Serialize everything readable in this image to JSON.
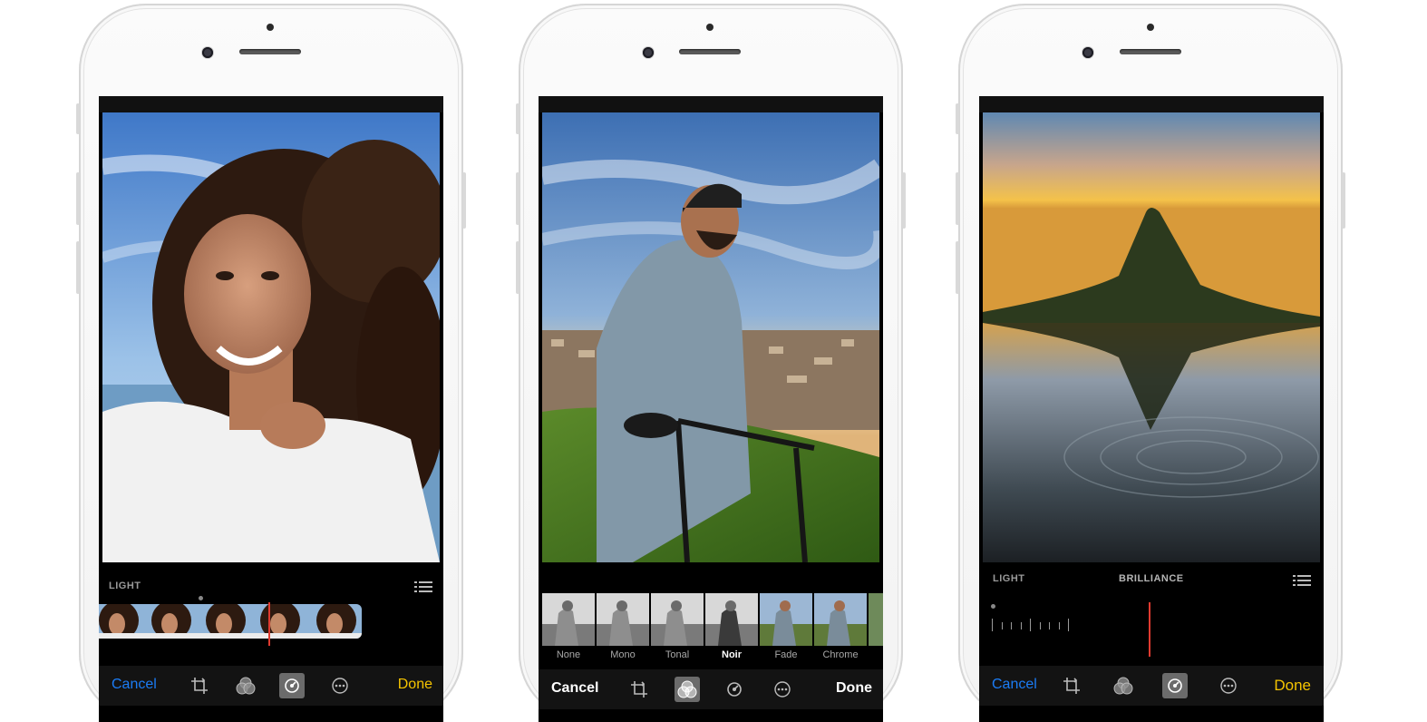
{
  "phones": [
    {
      "photo": "woman-portrait-photo",
      "panel": {
        "section_label": "LIGHT",
        "list_icon": "list-icon"
      },
      "toolbar": {
        "cancel_label": "Cancel",
        "done_label": "Done",
        "icons": [
          "crop-rotate-icon",
          "filters-icon",
          "adjust-dial-icon",
          "more-icon"
        ],
        "active_tool": "adjust-dial-icon"
      }
    },
    {
      "photo": "man-with-bike-photo",
      "filters": [
        "None",
        "Mono",
        "Tonal",
        "Noir",
        "Fade",
        "Chrome"
      ],
      "selected_filter": "Chrome",
      "current_filter": "Noir",
      "toolbar": {
        "cancel_label": "Cancel",
        "done_label": "Done",
        "icons": [
          "crop-rotate-icon",
          "filters-icon",
          "adjust-dial-icon",
          "more-icon"
        ],
        "active_tool": "filters-icon"
      }
    },
    {
      "photo": "mountain-lake-photo",
      "panel": {
        "section_label": "LIGHT",
        "sub_label": "BRILLIANCE",
        "list_icon": "list-icon",
        "slider_value": 0.5
      },
      "toolbar": {
        "cancel_label": "Cancel",
        "done_label": "Done",
        "icons": [
          "crop-rotate-icon",
          "filters-icon",
          "adjust-dial-icon",
          "more-icon"
        ],
        "active_tool": "adjust-dial-icon"
      }
    }
  ],
  "colors": {
    "cancel_blue": "#1b7cf5",
    "done_yellow": "#f5c400",
    "slider_red": "#e03a2f",
    "selected_blue": "#2f7cf6"
  }
}
